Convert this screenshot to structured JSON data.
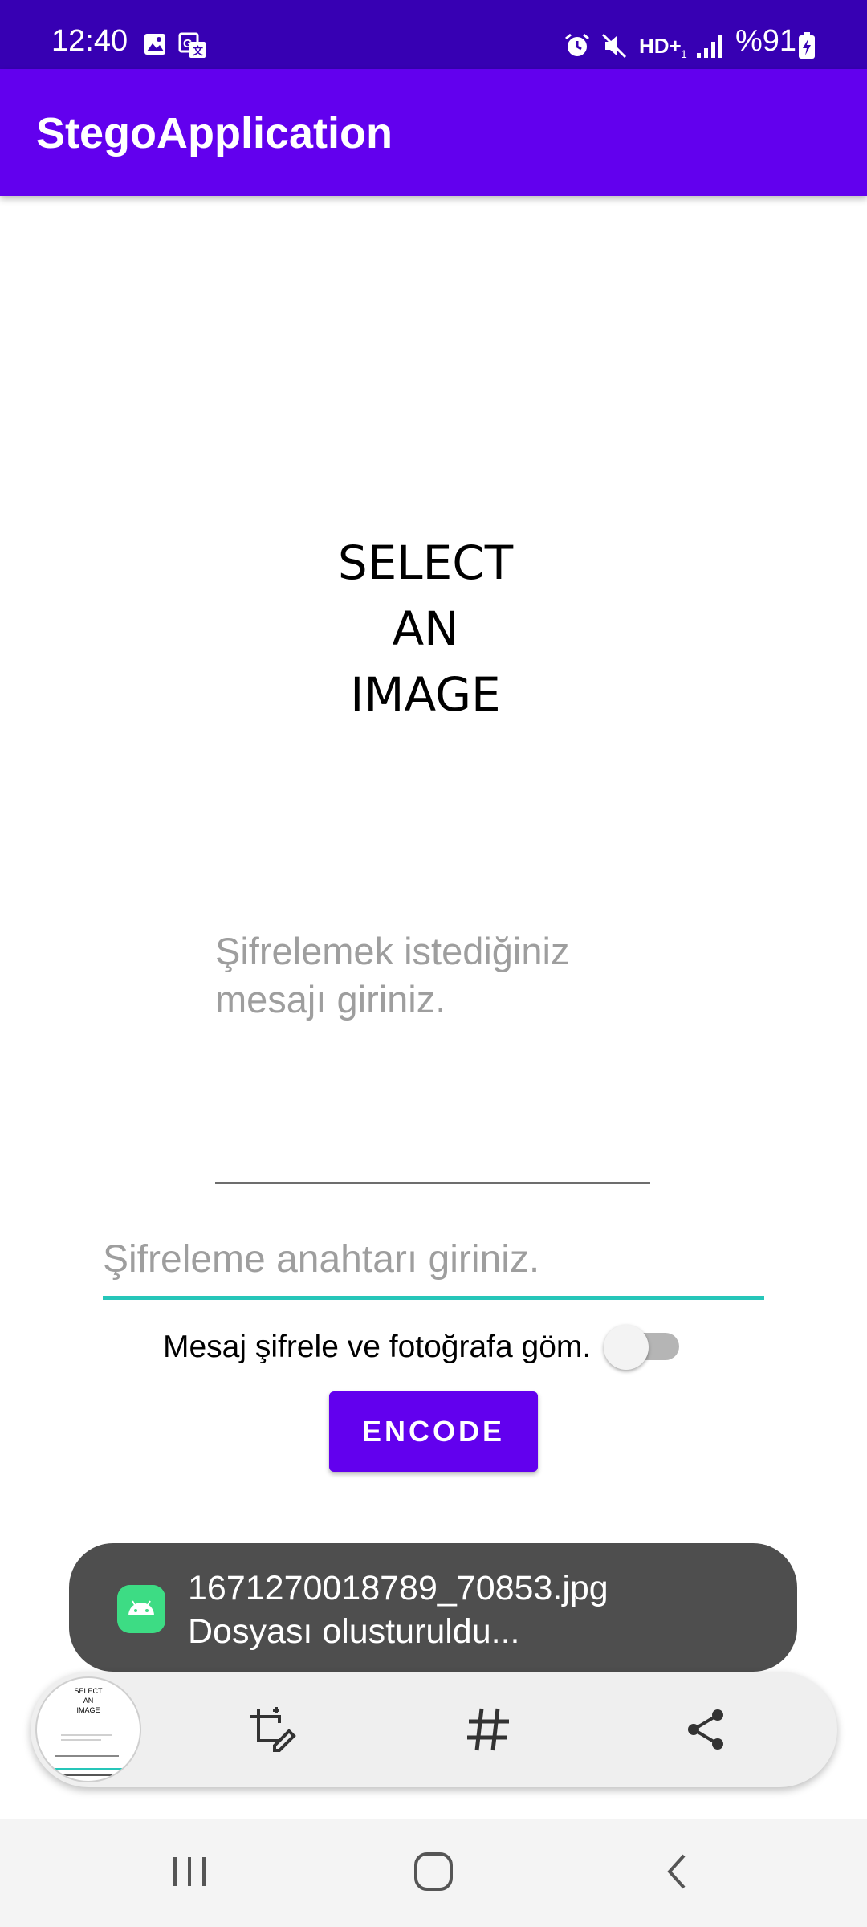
{
  "status_bar": {
    "time": "12:40",
    "battery": "%91",
    "left_icons": [
      "gallery-icon",
      "translate-icon"
    ],
    "right_icons": [
      "alarm-icon",
      "mute-icon",
      "hd-plus-icon",
      "signal-icon",
      "battery-charging-icon"
    ]
  },
  "app_bar": {
    "title": "StegoApplication"
  },
  "image_placeholder": {
    "text": "SELECT\nAN\nIMAGE"
  },
  "message_field": {
    "placeholder": "Şifrelemek istediğiniz\nmesajı giriniz."
  },
  "key_field": {
    "placeholder": "Şifreleme anahtarı giriniz."
  },
  "toggle": {
    "label": "Mesaj şifrele ve fotoğrafa göm.",
    "checked": false
  },
  "encode_button": {
    "label": "ENCODE"
  },
  "toast": {
    "line1": "1671270018789_70853.jpg",
    "line2": "Dosyası olusturuldu..."
  },
  "screenshot_toolbar": {
    "thumbnail_text": "SELECT\nAN\nIMAGE",
    "icons": [
      "crop-edit-icon",
      "hashtag-icon",
      "share-icon"
    ]
  },
  "nav_bar": {
    "icons": [
      "recents-icon",
      "home-icon",
      "back-icon"
    ]
  },
  "colors": {
    "status_bar": "#3700b3",
    "app_bar": "#6200ee",
    "accent": "#26c6b9",
    "toast_bg": "#4e4e4e"
  }
}
